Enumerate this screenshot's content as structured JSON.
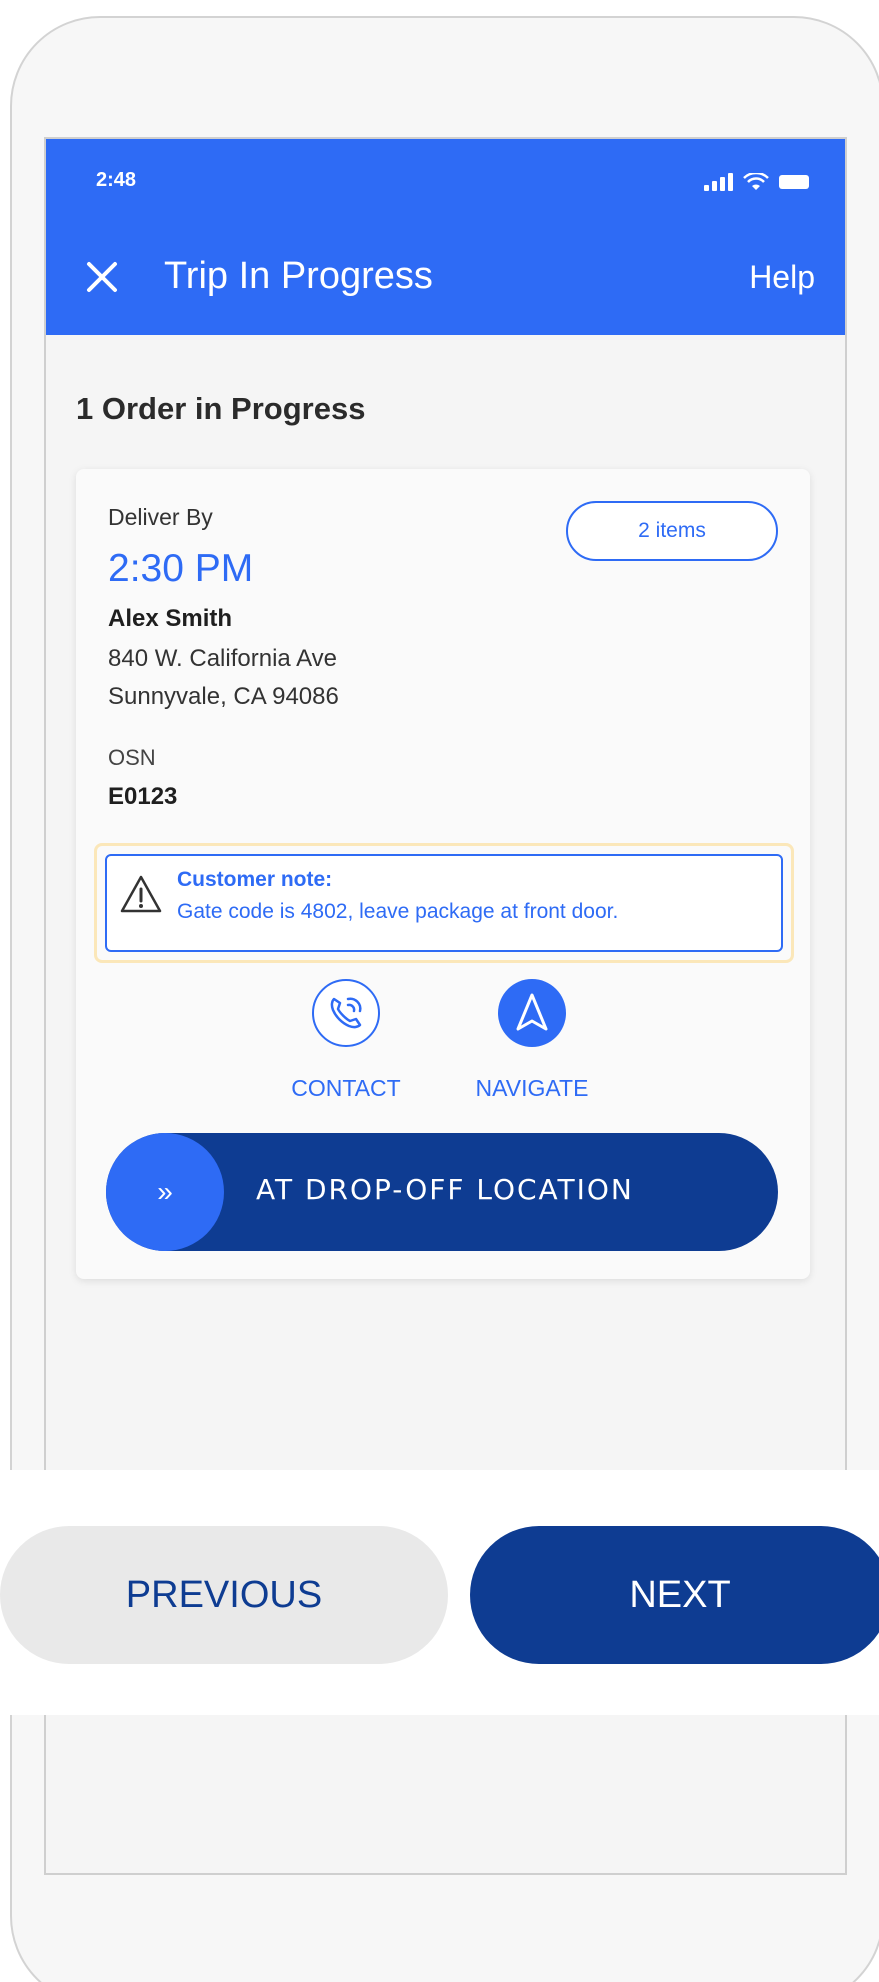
{
  "status_bar": {
    "time": "2:48"
  },
  "header": {
    "title": "Trip In Progress",
    "help_label": "Help"
  },
  "section": {
    "title": "1 Order in Progress"
  },
  "order": {
    "deliver_by_label": "Deliver By",
    "deliver_by_time": "2:30 PM",
    "items_badge": "2 items",
    "customer_name": "Alex Smith",
    "address_line1": "840 W. California Ave",
    "address_line2": "Sunnyvale, CA 94086",
    "osn_label": "OSN",
    "osn_value": "E0123",
    "note_title": "Customer note:",
    "note_text": "Gate code is 4802, leave package at front door."
  },
  "actions": {
    "contact_label": "CONTACT",
    "contact_icon": "phone-icon",
    "navigate_label": "NAVIGATE",
    "navigate_icon": "navigation-arrow-icon"
  },
  "slider": {
    "label": "AT DROP-OFF LOCATION",
    "chevron": "»"
  },
  "footer": {
    "previous_label": "PREVIOUS",
    "next_label": "NEXT"
  },
  "colors": {
    "primary_blue": "#2e6bf5",
    "dark_navy": "#0e3c92",
    "note_highlight": "#fbe7b9",
    "button_grey": "#e9e9e9"
  }
}
